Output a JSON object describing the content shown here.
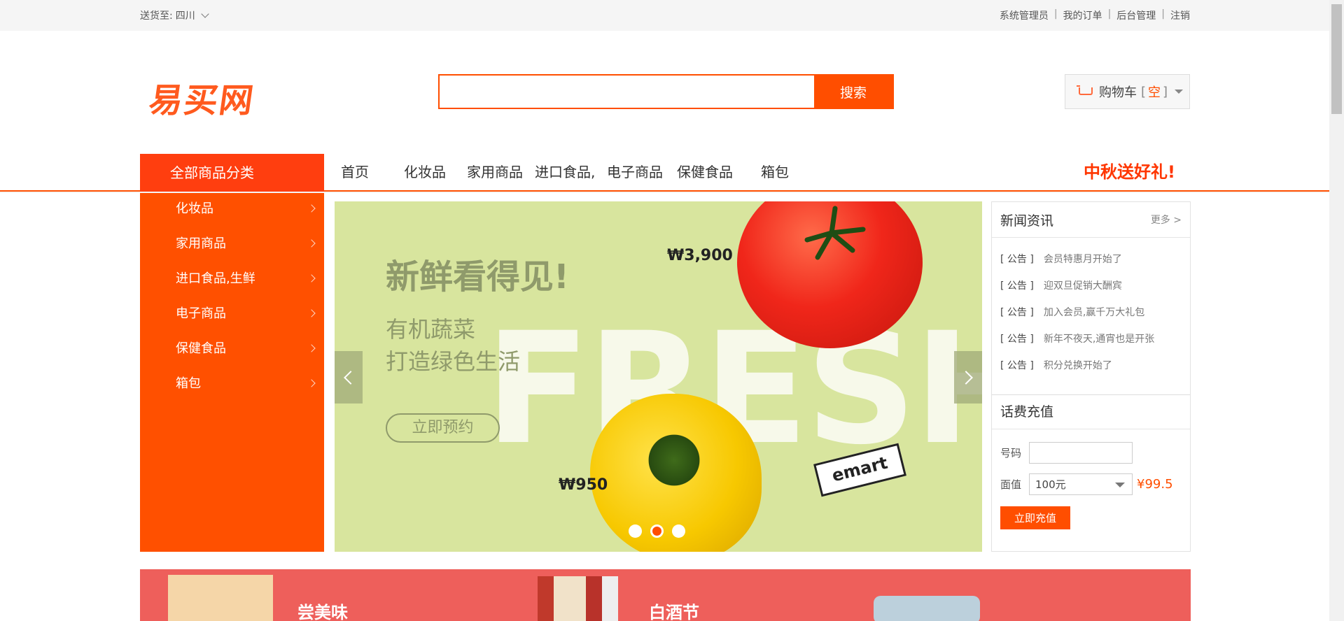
{
  "topbar": {
    "location_label": "送货至:",
    "location_value": "四川",
    "links": [
      "系统管理员",
      "我的订单",
      "后台管理",
      "注销"
    ],
    "separator": "|"
  },
  "header": {
    "logo_text": "易买网",
    "search": {
      "placeholder": "",
      "button_label": "搜索"
    },
    "cart": {
      "label": "购物车",
      "bracket_open": "[",
      "status": "空",
      "bracket_close": "]"
    }
  },
  "nav": {
    "all_categories": "全部商品分类",
    "items": [
      "首页",
      "化妆品",
      "家用商品",
      "进口食品,",
      "电子商品",
      "保健食品",
      "箱包"
    ],
    "promo": "中秋送好礼!"
  },
  "sidebar": {
    "categories": [
      "化妆品",
      "家用商品",
      "进口食品,生鲜",
      "电子商品",
      "保健食品",
      "箱包"
    ]
  },
  "banner": {
    "headline": "新鲜看得见!",
    "sub1": "有机蔬菜",
    "sub2": "打造绿色生活",
    "cta": "立即预约",
    "bg_word": "FRESH",
    "price1": "₩3,900",
    "price2": "₩950",
    "brand": "emart",
    "slides_total": 3,
    "active_slide": 2
  },
  "news": {
    "title": "新闻资讯",
    "more": "更多 >",
    "items": [
      {
        "tag": "[ 公告 ]",
        "text": "会员特惠月开始了"
      },
      {
        "tag": "[ 公告 ]",
        "text": "迎双旦促销大酬宾"
      },
      {
        "tag": "[ 公告 ]",
        "text": "加入会员,赢千万大礼包"
      },
      {
        "tag": "[ 公告 ]",
        "text": "新年不夜天,通宵也是开张"
      },
      {
        "tag": "[ 公告 ]",
        "text": "积分兑换开始了"
      }
    ]
  },
  "recharge": {
    "title": "话费充值",
    "phone_label": "号码",
    "phone_value": "",
    "amount_label": "面值",
    "amount_value": "100元",
    "price": "¥99.5",
    "button": "立即充值"
  },
  "promo_strip": {
    "left_title": "尝美味",
    "center_title": "白酒节"
  },
  "colors": {
    "accent": "#ff4e00",
    "nav_category_bg": "#ff3e0f",
    "banner_bg": "#d8e59e",
    "promo_strip_bg": "#ee5f5b"
  }
}
